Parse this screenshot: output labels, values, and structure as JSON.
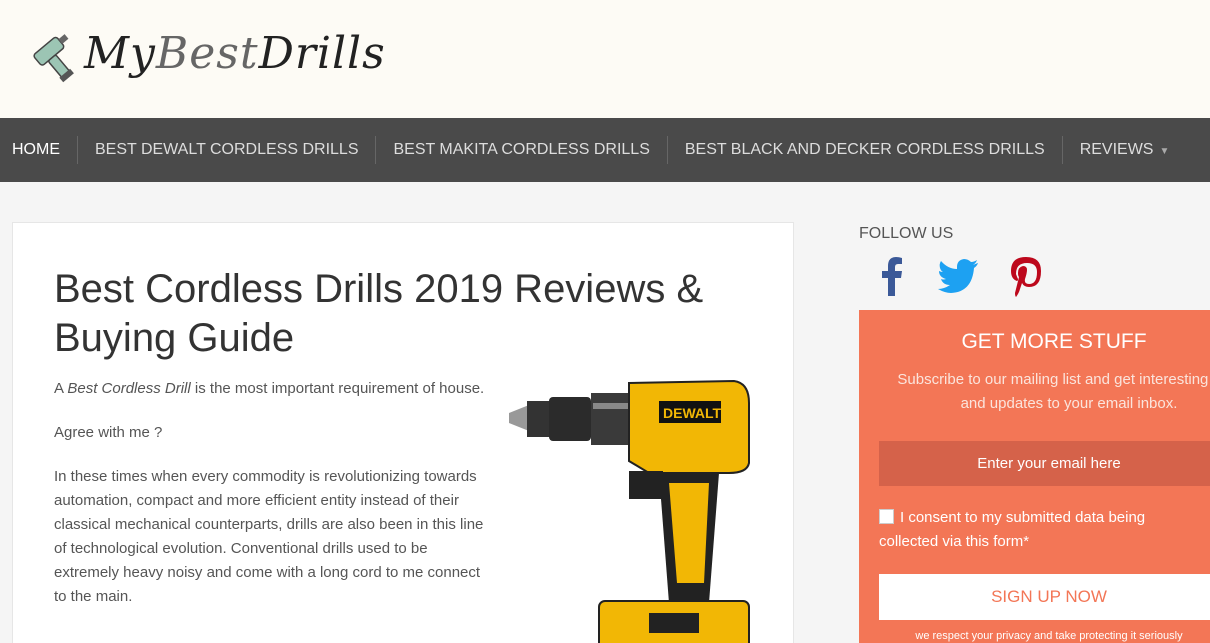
{
  "site": {
    "logo_text_my": "My",
    "logo_text_best": "Best",
    "logo_text_drills": "Drills"
  },
  "nav": {
    "items": [
      {
        "label": "HOME"
      },
      {
        "label": "BEST DEWALT CORDLESS DRILLS"
      },
      {
        "label": "BEST MAKITA CORDLESS DRILLS"
      },
      {
        "label": "BEST BLACK AND DECKER CORDLESS DRILLS"
      },
      {
        "label": "REVIEWS"
      }
    ]
  },
  "article": {
    "title": "Best Cordless Drills 2019 Reviews & Buying Guide",
    "p1_prefix": "A ",
    "p1_em": "Best Cordless Drill",
    "p1_suffix": " is the most important requirement of house.",
    "p2": "Agree with me ?",
    "p3": "In these times when every commodity is revolutionizing towards automation, compact and more efficient entity instead of their classical mechanical counterparts, drills are also been in this line of technological evolution. Conventional drills used to be extremely heavy noisy and come with a long cord to me connect to the main.",
    "image_brand": "DEWALT"
  },
  "sidebar": {
    "follow_label": "FOLLOW US",
    "social_icons": [
      "facebook-icon",
      "twitter-icon",
      "pinterest-icon"
    ],
    "optin": {
      "title": "GET MORE STUFF",
      "description": "Subscribe to our mailing list and get interesting stuff and updates to your email inbox.",
      "email_placeholder": "Enter your email here",
      "consent_text": "I consent to my submitted data being collected via this form*",
      "signup_label": "SIGN UP NOW",
      "privacy_text": "we respect your privacy and take protecting it seriously"
    }
  },
  "colors": {
    "nav_bg": "#4a4a4a",
    "optin_bg": "#f37656",
    "facebook": "#3b5998",
    "twitter": "#1da1f2",
    "pinterest": "#bd081c"
  }
}
